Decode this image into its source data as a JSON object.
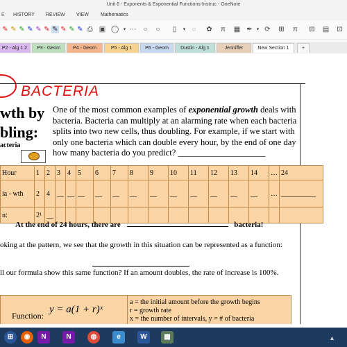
{
  "window": {
    "title": "Unit 6 - Exponents & Exponential Functions-Instruc - OneNote"
  },
  "menu": [
    "HISTORY",
    "REVIEW",
    "VIEW",
    "Mathematics"
  ],
  "tabs": [
    "P2 - Alg 1 2",
    "P3 - Geom",
    "P4 - Geom",
    "P5 - Alg 1",
    "P6 - Geom",
    "Dustin - Alg 1",
    "Jenniffer",
    "New Section 1",
    "+"
  ],
  "page": {
    "hand_title": "BACTERIA",
    "heading_1": "wth by",
    "heading_2": "bling:",
    "subheading": "acteria",
    "paragraph": "One of the most common examples of exponential growth deals with bacteria. Bacteria can multiply at an alarming rate when each bacteria splits into two new cells, thus doubling. For example, if we start with only one bacteria which can double every hour, by the end of one day how many bacteria do you predict? ____________________",
    "paragraph_emph": "exponential growth",
    "table": {
      "row_label_hour": "Hour",
      "hours": [
        "1",
        "2",
        "3",
        "4",
        "5",
        "6",
        "7",
        "8",
        "9",
        "10",
        "11",
        "12",
        "13",
        "14",
        "…",
        "24"
      ],
      "row_label_growth": "ia - wth",
      "growth": [
        "2",
        "4",
        "__",
        "__",
        "__",
        "__",
        "__",
        "__",
        "__",
        "__",
        "__",
        "__",
        "__",
        "__",
        "…",
        "__________"
      ],
      "row_label_exp": "n:",
      "exp_first": "2¹",
      "exp_rest": "__"
    },
    "sentence_end": "At the end of 24 hours, there are",
    "sentence_tail": "bacteria!",
    "pattern_text": "oking at the pattern, we see that the growth in this situation can be represented as a function:",
    "formula_q": "ll our formula show this same function?  If an amount doubles, the rate of increase is 100%.",
    "function_label": "Function:",
    "function_formula": "y = a(1 + r)ˣ",
    "defs": [
      "a = the initial amount before the growth begins",
      "r = growth rate",
      "x = the number of intervals,  y = # of bacteria"
    ]
  },
  "taskbar": {
    "apps": [
      "start",
      "firefox",
      "onenote",
      "onenote2",
      "chrome",
      "explorer",
      "word",
      "calculator"
    ]
  }
}
